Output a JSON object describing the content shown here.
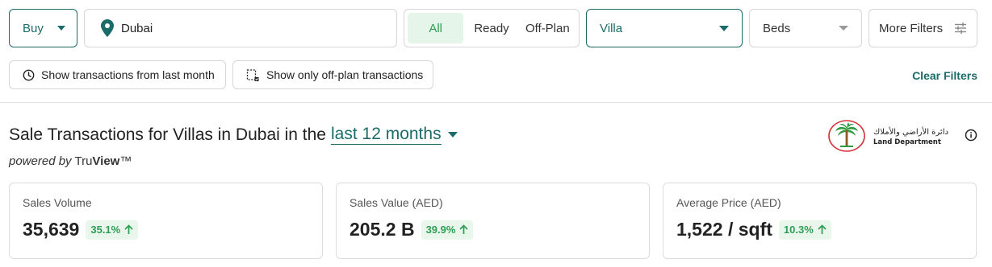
{
  "filters": {
    "purpose": "Buy",
    "location": "Dubai",
    "completion": {
      "options": [
        "All",
        "Ready",
        "Off-Plan"
      ],
      "selected": "All"
    },
    "property_type": "Villa",
    "beds": "Beds",
    "more_filters": "More Filters",
    "chips": {
      "last_month": "Show transactions from last month",
      "off_plan": "Show only off-plan transactions"
    },
    "clear": "Clear Filters"
  },
  "heading": {
    "prefix": "Sale Transactions for Villas in Dubai in the",
    "period": "last 12 months"
  },
  "powered_by": {
    "prefix": "powered by",
    "brand_a": "Tru",
    "brand_b": "View",
    "tm": "™"
  },
  "logo": {
    "arabic": "دائرة الأراضي والأملاك",
    "english": "Land Department"
  },
  "stats": [
    {
      "label": "Sales Volume",
      "value": "35,639",
      "change": "35.1%",
      "direction": "up"
    },
    {
      "label": "Sales Value (AED)",
      "value": "205.2 B",
      "change": "39.9%",
      "direction": "up"
    },
    {
      "label": "Average Price (AED)",
      "value": "1,522 / sqft",
      "change": "10.3%",
      "direction": "up"
    }
  ],
  "colors": {
    "brand": "#1b6b68",
    "positive": "#2f9e55",
    "positive_bg": "#e8f6ec"
  }
}
